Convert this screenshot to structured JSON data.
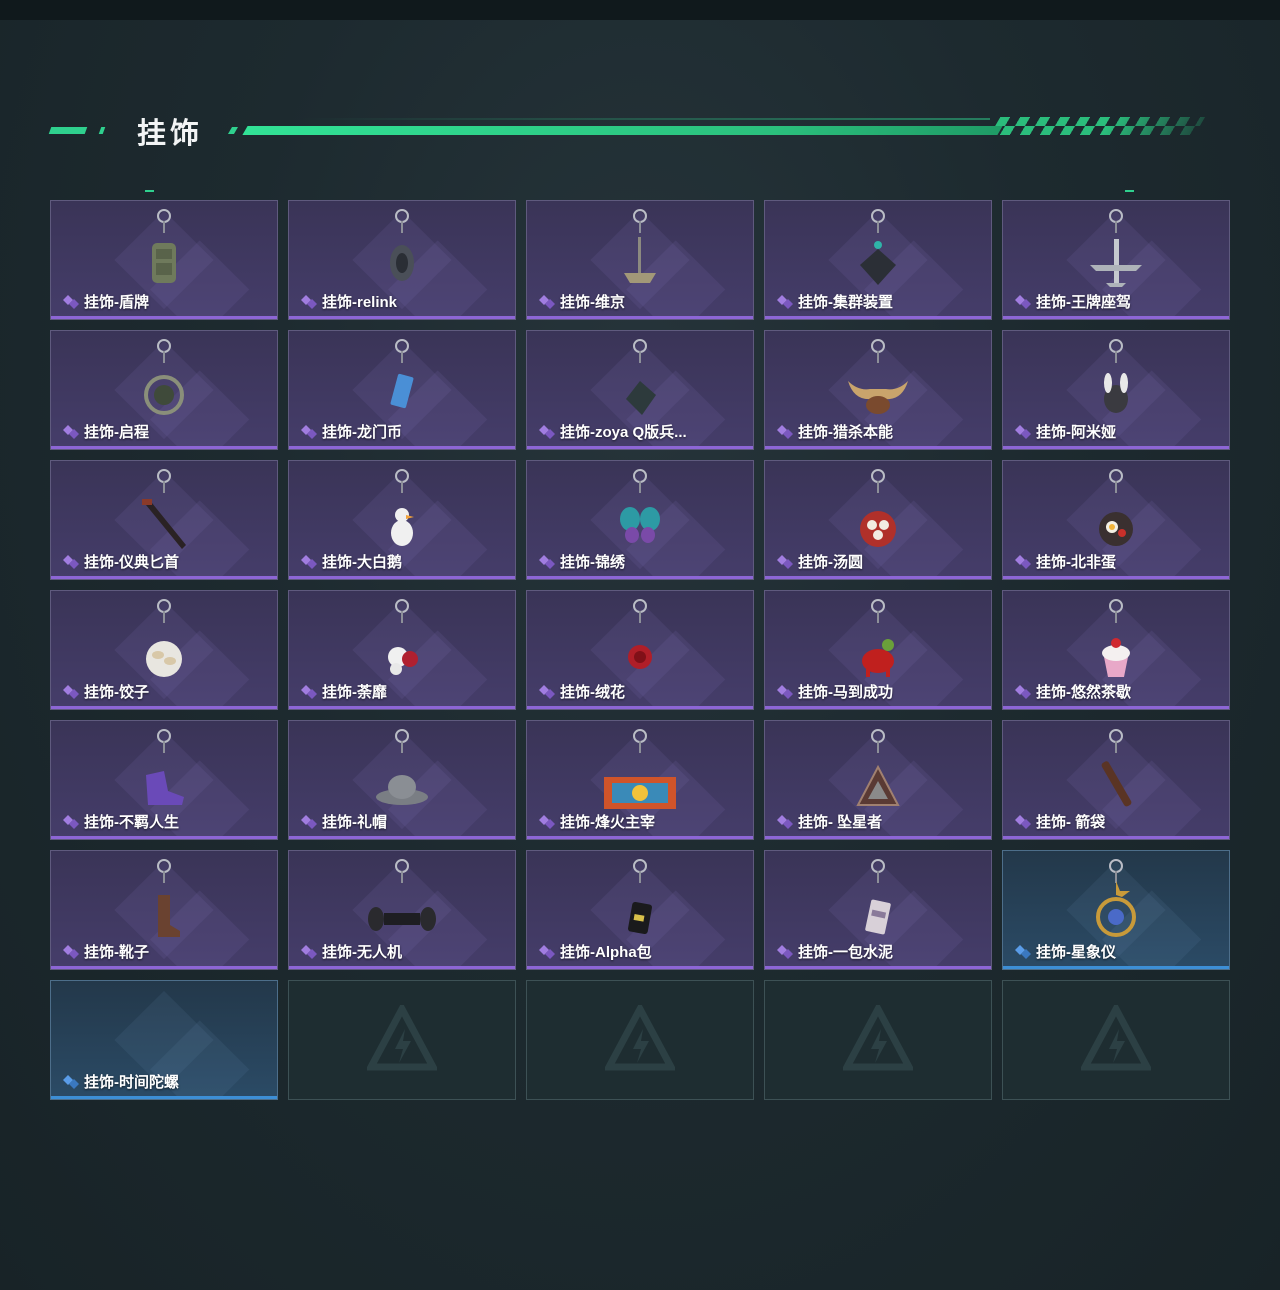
{
  "page": {
    "title": "挂饰"
  },
  "items": [
    {
      "label": "挂饰-盾牌",
      "rarity": "purple",
      "icon": "shield-charm-icon"
    },
    {
      "label": "挂饰-relink",
      "rarity": "purple",
      "icon": "shell-charm-icon"
    },
    {
      "label": "挂饰-维京",
      "rarity": "purple",
      "icon": "hammer-charm-icon"
    },
    {
      "label": "挂饰-集群装置",
      "rarity": "purple",
      "icon": "cube-device-charm-icon"
    },
    {
      "label": "挂饰-王牌座驾",
      "rarity": "purple",
      "icon": "jet-plane-charm-icon"
    },
    {
      "label": "挂饰-启程",
      "rarity": "purple",
      "icon": "badge-charm-icon"
    },
    {
      "label": "挂饰-龙门币",
      "rarity": "purple",
      "icon": "card-charm-icon"
    },
    {
      "label": "挂饰-zoya  Q版兵...",
      "rarity": "purple",
      "icon": "dark-cube-charm-icon"
    },
    {
      "label": "挂饰-猎杀本能",
      "rarity": "purple",
      "icon": "moose-antler-charm-icon"
    },
    {
      "label": "挂饰-阿米娅",
      "rarity": "purple",
      "icon": "rabbit-charm-icon"
    },
    {
      "label": "挂饰-仪典匕首",
      "rarity": "purple",
      "icon": "dagger-charm-icon"
    },
    {
      "label": "挂饰-大白鹅",
      "rarity": "purple",
      "icon": "goose-charm-icon"
    },
    {
      "label": "挂饰-锦绣",
      "rarity": "purple",
      "icon": "butterfly-charm-icon"
    },
    {
      "label": "挂饰-汤圆",
      "rarity": "purple",
      "icon": "dumpling-bowl-charm-icon"
    },
    {
      "label": "挂饰-北非蛋",
      "rarity": "purple",
      "icon": "egg-pan-charm-icon"
    },
    {
      "label": "挂饰-饺子",
      "rarity": "purple",
      "icon": "dumplings-plate-charm-icon"
    },
    {
      "label": "挂饰-荼靡",
      "rarity": "purple",
      "icon": "flower-charm-icon"
    },
    {
      "label": "挂饰-绒花",
      "rarity": "purple",
      "icon": "rose-charm-icon"
    },
    {
      "label": "挂饰-马到成功",
      "rarity": "purple",
      "icon": "red-horse-charm-icon"
    },
    {
      "label": "挂饰-悠然茶歇",
      "rarity": "purple",
      "icon": "cupcake-charm-icon"
    },
    {
      "label": "挂饰-不羁人生",
      "rarity": "purple",
      "icon": "sneaker-charm-icon"
    },
    {
      "label": "挂饰-礼帽",
      "rarity": "purple",
      "icon": "fedora-hat-charm-icon"
    },
    {
      "label": "挂饰-烽火主宰",
      "rarity": "purple",
      "icon": "container-charm-icon"
    },
    {
      "label": "挂饰- 坠星者",
      "rarity": "purple",
      "icon": "triangle-emblem-charm-icon"
    },
    {
      "label": "挂饰- 箭袋",
      "rarity": "purple",
      "icon": "quiver-charm-icon"
    },
    {
      "label": "挂饰-靴子",
      "rarity": "purple",
      "icon": "boot-charm-icon"
    },
    {
      "label": "挂饰-无人机",
      "rarity": "purple",
      "icon": "drone-charm-icon"
    },
    {
      "label": "挂饰-Alpha包",
      "rarity": "purple",
      "icon": "pouch-charm-icon"
    },
    {
      "label": "挂饰-一包水泥",
      "rarity": "purple",
      "icon": "cement-bag-charm-icon"
    },
    {
      "label": "挂饰-星象仪",
      "rarity": "blue",
      "icon": "astrolabe-charm-icon"
    },
    {
      "label": "挂饰-时间陀螺",
      "rarity": "blue",
      "icon": ""
    }
  ],
  "empty_slots": 4,
  "colors": {
    "accent_green": "#2fd08e",
    "purple_rarity": "#8d66d6",
    "blue_rarity": "#3d8fd6",
    "background": "#1d2a2f"
  }
}
